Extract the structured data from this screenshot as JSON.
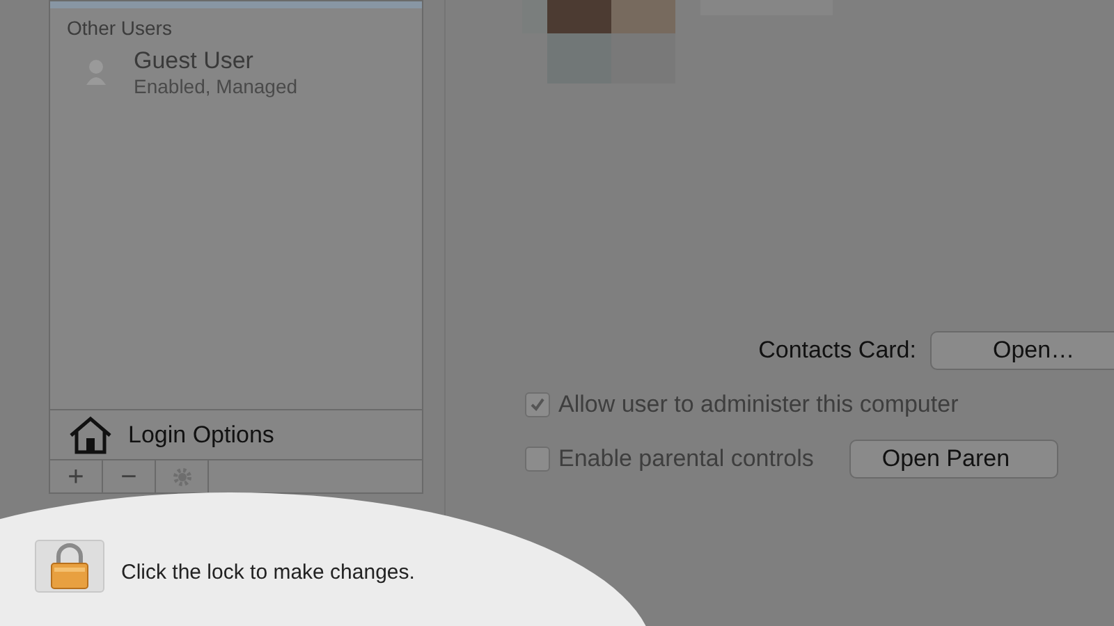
{
  "sidebar": {
    "section_header": "Other Users",
    "users": [
      {
        "name": "Guest User",
        "status": "Enabled, Managed",
        "selected": false
      }
    ],
    "login_options": "Login Options",
    "toolbar": [
      "+",
      "−"
    ]
  },
  "contacts_card": {
    "label": "Contacts Card:",
    "button": "Open…"
  },
  "options": [
    {
      "label": "Allow user to administer this computer",
      "checked": true,
      "disabled": true
    },
    {
      "label": "Enable parental controls",
      "checked": false,
      "disabled": true,
      "button": "Open Paren"
    }
  ],
  "lock": {
    "locked": true,
    "message": "Click the lock to make changes."
  }
}
